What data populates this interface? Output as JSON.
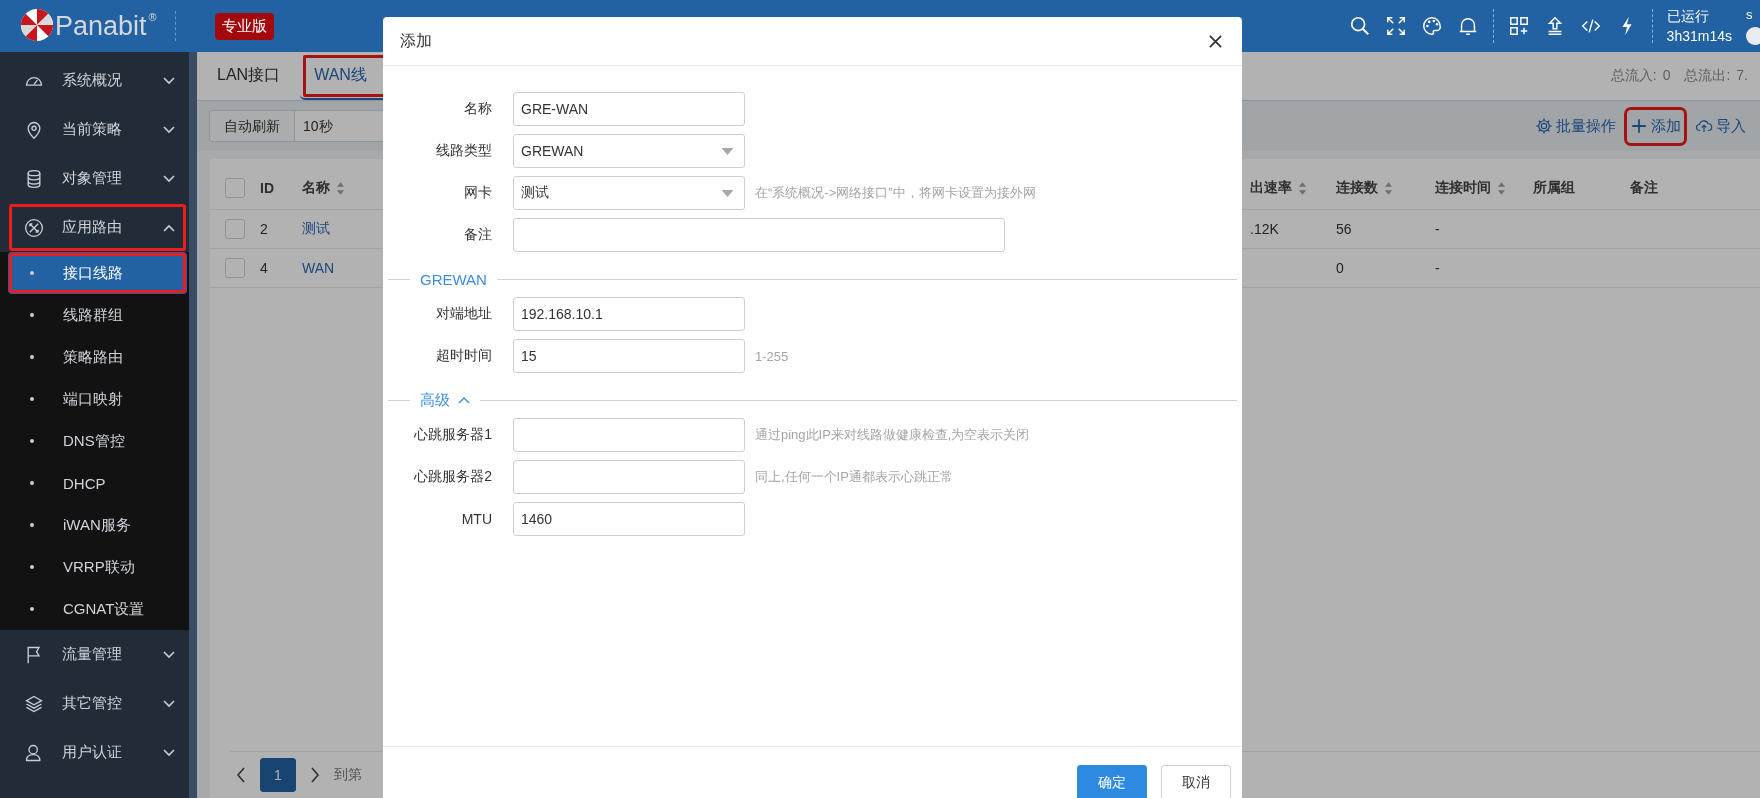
{
  "header": {
    "logo": "Panabit",
    "logo_mark": "®",
    "edition": "专业版",
    "uptime_label": "已运行",
    "uptime": "3h31m14s",
    "user_initial": "s"
  },
  "sidebar": {
    "items": [
      {
        "label": "系统概况",
        "expanded": false,
        "highlighted": false
      },
      {
        "label": "当前策略",
        "expanded": false,
        "highlighted": false
      },
      {
        "label": "对象管理",
        "expanded": false,
        "highlighted": false
      },
      {
        "label": "应用路由",
        "expanded": true,
        "highlighted": true,
        "children": [
          {
            "label": "接口线路",
            "selected": true,
            "highlighted": true
          },
          {
            "label": "线路群组",
            "selected": false,
            "highlighted": false
          },
          {
            "label": "策略路由",
            "selected": false,
            "highlighted": false
          },
          {
            "label": "端口映射",
            "selected": false,
            "highlighted": false
          },
          {
            "label": "DNS管控",
            "selected": false,
            "highlighted": false
          },
          {
            "label": "DHCP",
            "selected": false,
            "highlighted": false
          },
          {
            "label": "iWAN服务",
            "selected": false,
            "highlighted": false
          },
          {
            "label": "VRRP联动",
            "selected": false,
            "highlighted": false
          },
          {
            "label": "CGNAT设置",
            "selected": false,
            "highlighted": false
          }
        ]
      },
      {
        "label": "流量管理",
        "expanded": false,
        "highlighted": false
      },
      {
        "label": "其它管控",
        "expanded": false,
        "highlighted": false
      },
      {
        "label": "用户认证",
        "expanded": false,
        "highlighted": false
      }
    ]
  },
  "tabs": [
    {
      "label": "LAN接口",
      "selected": false,
      "highlighted": false
    },
    {
      "label": "WAN线",
      "selected": true,
      "highlighted": true
    }
  ],
  "totals": [
    {
      "label": "总流入:",
      "value": "0"
    },
    {
      "label": "总流出:",
      "value": "7."
    }
  ],
  "toolbar": {
    "refresh_label": "自动刷新",
    "refresh_interval": "10秒",
    "actions": [
      {
        "label": "批量操作",
        "kind": "batch",
        "highlighted": false
      },
      {
        "label": "添加",
        "kind": "add",
        "highlighted": true
      },
      {
        "label": "导入",
        "kind": "import",
        "highlighted": false
      }
    ]
  },
  "table": {
    "all_checked": false,
    "columns_left": [
      {
        "label": "ID",
        "sortable": false
      },
      {
        "label": "名称",
        "sortable": true
      }
    ],
    "columns_right": [
      {
        "label": "出速率",
        "sortable": true
      },
      {
        "label": "连接数",
        "sortable": true
      },
      {
        "label": "连接时间",
        "sortable": true
      },
      {
        "label": "所属组",
        "sortable": false
      },
      {
        "label": "备注",
        "sortable": false
      }
    ],
    "rows": [
      {
        "checked": false,
        "id": "2",
        "name": "测试",
        "out_rate": ".12K",
        "connections": "56",
        "conn_time": "-"
      },
      {
        "checked": false,
        "id": "4",
        "name": "WAN",
        "connections": "0",
        "conn_time": "-"
      }
    ]
  },
  "pagination": {
    "pages": [
      {
        "label": "1",
        "selected": true
      }
    ],
    "goto_label": "到第"
  },
  "dialog": {
    "title": "添加",
    "sections": [
      {
        "fields": [
          {
            "label": "名称",
            "kind": "text",
            "value": "GRE-WAN"
          },
          {
            "label": "线路类型",
            "kind": "select",
            "value": "GREWAN"
          },
          {
            "label": "网卡",
            "kind": "select",
            "value": "测试",
            "hint": "在“系统概况->网络接口”中，将网卡设置为接外网"
          },
          {
            "label": "备注",
            "kind": "text",
            "wide": true
          }
        ]
      },
      {
        "title": "GREWAN",
        "fields": [
          {
            "label": "对端地址",
            "kind": "text",
            "value": "192.168.10.1"
          },
          {
            "label": "超时时间",
            "kind": "text",
            "value": "15",
            "hint": "1-255"
          }
        ]
      },
      {
        "title": "高级",
        "collapsible": true,
        "expanded": true,
        "fields": [
          {
            "label": "心跳服务器1",
            "kind": "text",
            "hint": "通过ping此IP来对线路做健康检查,为空表示关闭"
          },
          {
            "label": "心跳服务器2",
            "kind": "text",
            "hint": "同上,任何一个IP通都表示心跳正常"
          },
          {
            "label": "MTU",
            "kind": "text",
            "value": "1460"
          }
        ]
      }
    ],
    "buttons": [
      {
        "label": "确定",
        "primary": true
      },
      {
        "label": "取消",
        "primary": false
      }
    ]
  }
}
